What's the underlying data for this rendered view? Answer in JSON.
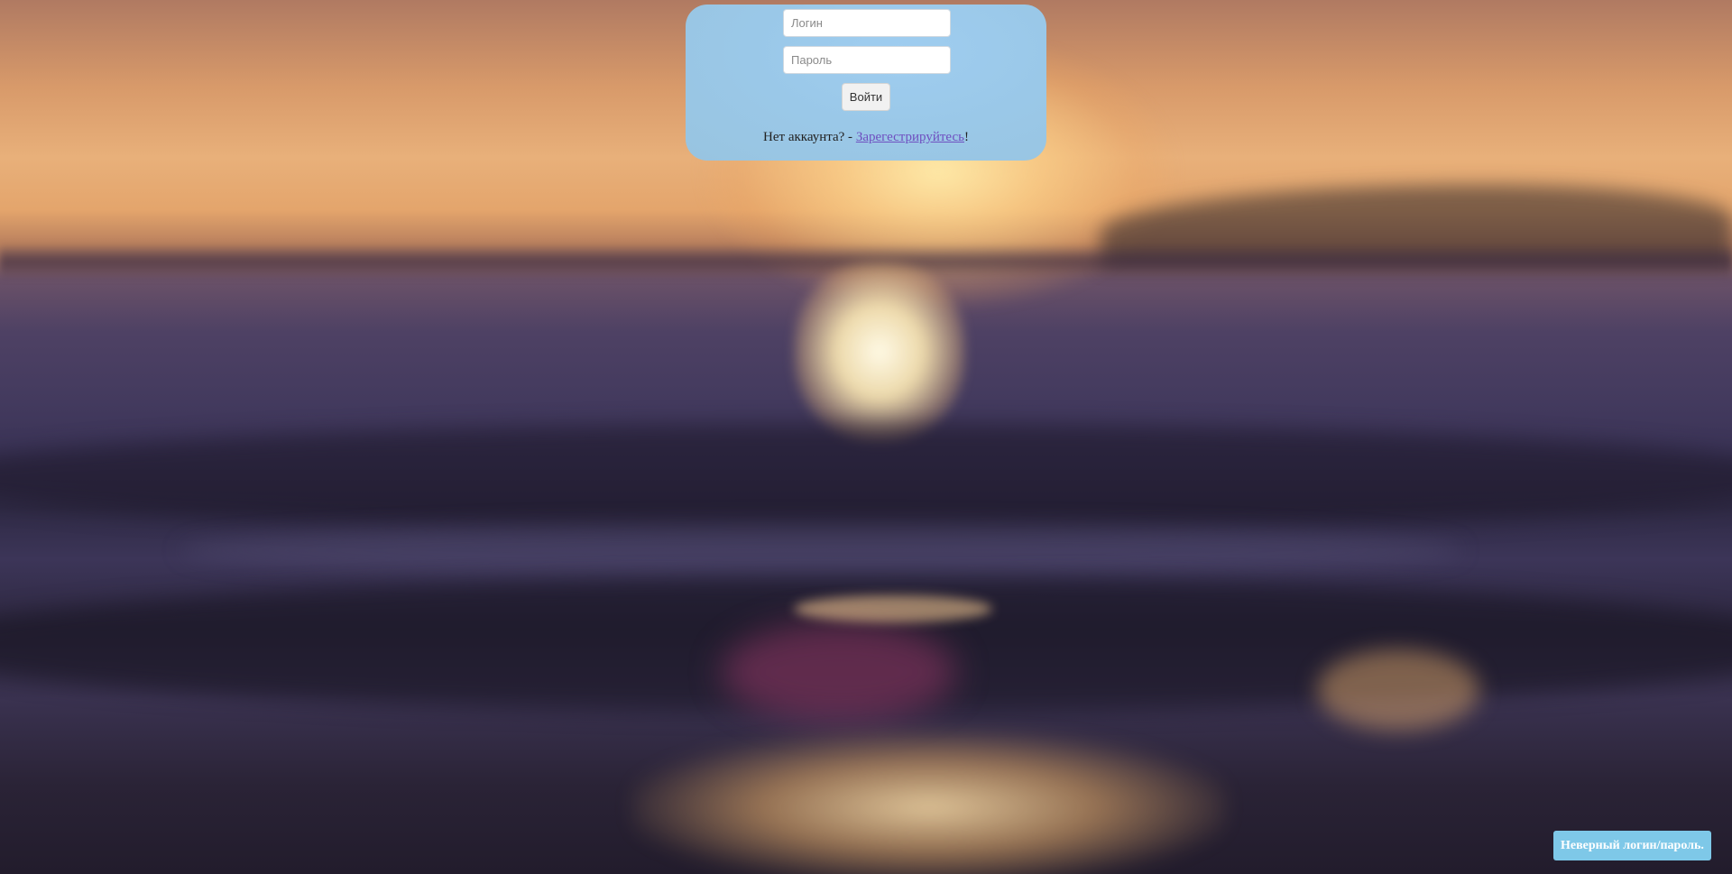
{
  "login_form": {
    "login_placeholder": "Логин",
    "login_value": "",
    "password_placeholder": "Пароль",
    "password_value": "",
    "submit_label": "Войти",
    "register_prefix": "Нет аккаунта? - ",
    "register_link": "Зарегестрируйтесь",
    "register_suffix": "!"
  },
  "notification": {
    "message": "Неверный логин/пароль."
  },
  "colors": {
    "panel_bg": "#9ac8e8",
    "link": "#6f4fc0",
    "toast_bg": "#7ec8e8"
  }
}
